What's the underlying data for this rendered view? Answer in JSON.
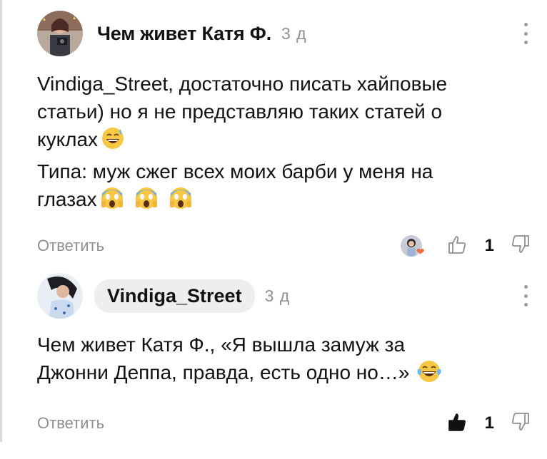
{
  "comments": [
    {
      "author": "Чем живет Катя Ф.",
      "time": "3 д",
      "line1": "Vindiga_Street, достаточно писать хайповые",
      "line2": "статьи) но я не представляю таких статей о",
      "line3": "куклах",
      "line4": "Типа: муж сжег всех моих барби у меня на",
      "line5": "глазах",
      "reply_label": "Ответить",
      "like_count": "1"
    },
    {
      "author": "Vindiga_Street",
      "time": "3 д",
      "line1": "Чем живет Катя Ф., «Я вышла замуж за",
      "line2": "Джонни Деппа, правда, есть одно но…»",
      "reply_label": "Ответить",
      "like_count": "1"
    }
  ],
  "icons": {
    "sweat_smile": "grinning-sweat-emoji-icon",
    "scream": "screaming-face-emoji-icon",
    "joy": "tears-of-joy-emoji-icon",
    "like": "thumbs-up-icon",
    "dislike": "thumbs-down-icon",
    "menu": "more-vertical-icon"
  }
}
